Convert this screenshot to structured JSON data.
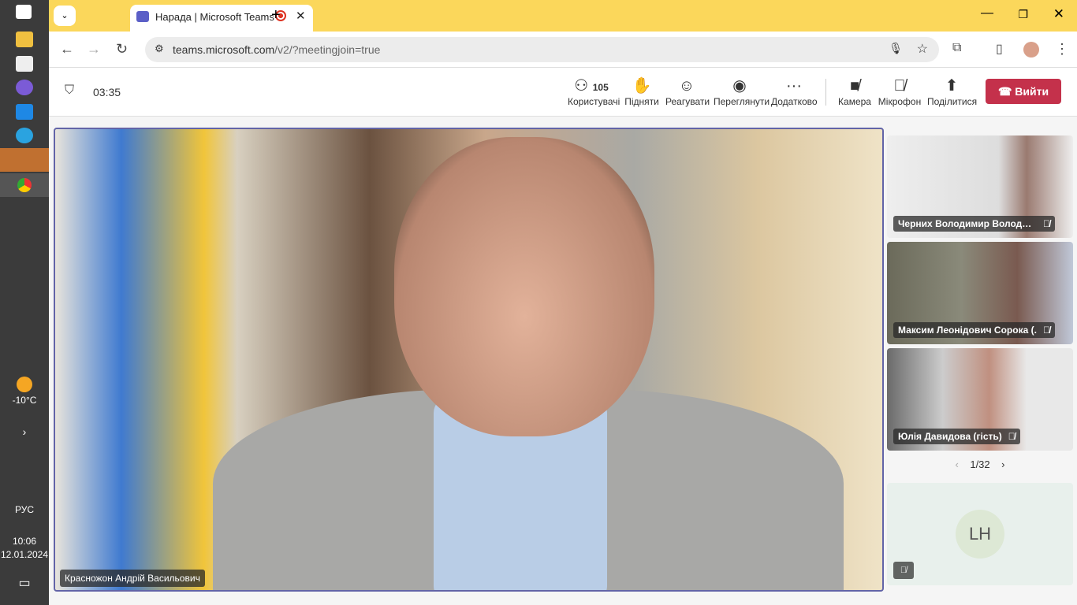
{
  "taskbar": {
    "weather": "-10°C",
    "lang": "РУС",
    "time": "10:06",
    "date": "12.01.2024"
  },
  "browser": {
    "tab_title": "Нарада | Microsoft Teams",
    "url_host": "teams.microsoft.com",
    "url_path": "/v2/?meetingjoin=true"
  },
  "meeting": {
    "timer": "03:35",
    "participants_count": "105",
    "tools": [
      {
        "label": "Користувачі",
        "icon": "people-icon"
      },
      {
        "label": "Підняти",
        "icon": "hand-icon"
      },
      {
        "label": "Реагувати",
        "icon": "smile-icon"
      },
      {
        "label": "Переглянути",
        "icon": "view-icon"
      },
      {
        "label": "Додатково",
        "icon": "more-icon"
      },
      {
        "label": "Камера",
        "icon": "camera-off-icon"
      },
      {
        "label": "Мікрофон",
        "icon": "mic-off-icon"
      },
      {
        "label": "Поділитися",
        "icon": "share-icon"
      }
    ],
    "leave_label": "Вийти",
    "speaker": "Красножон Андрій Васильович",
    "tiles": [
      "Черних Володимир Володимирович",
      "Максим Леонідович Сорока (...",
      "Юлія Давидова (гість)"
    ],
    "pager": "1/32",
    "avatar_initials": "LH"
  },
  "colors": {
    "accent": "#6264a7",
    "leave": "#c4314b",
    "chrome": "#fbd75b"
  }
}
